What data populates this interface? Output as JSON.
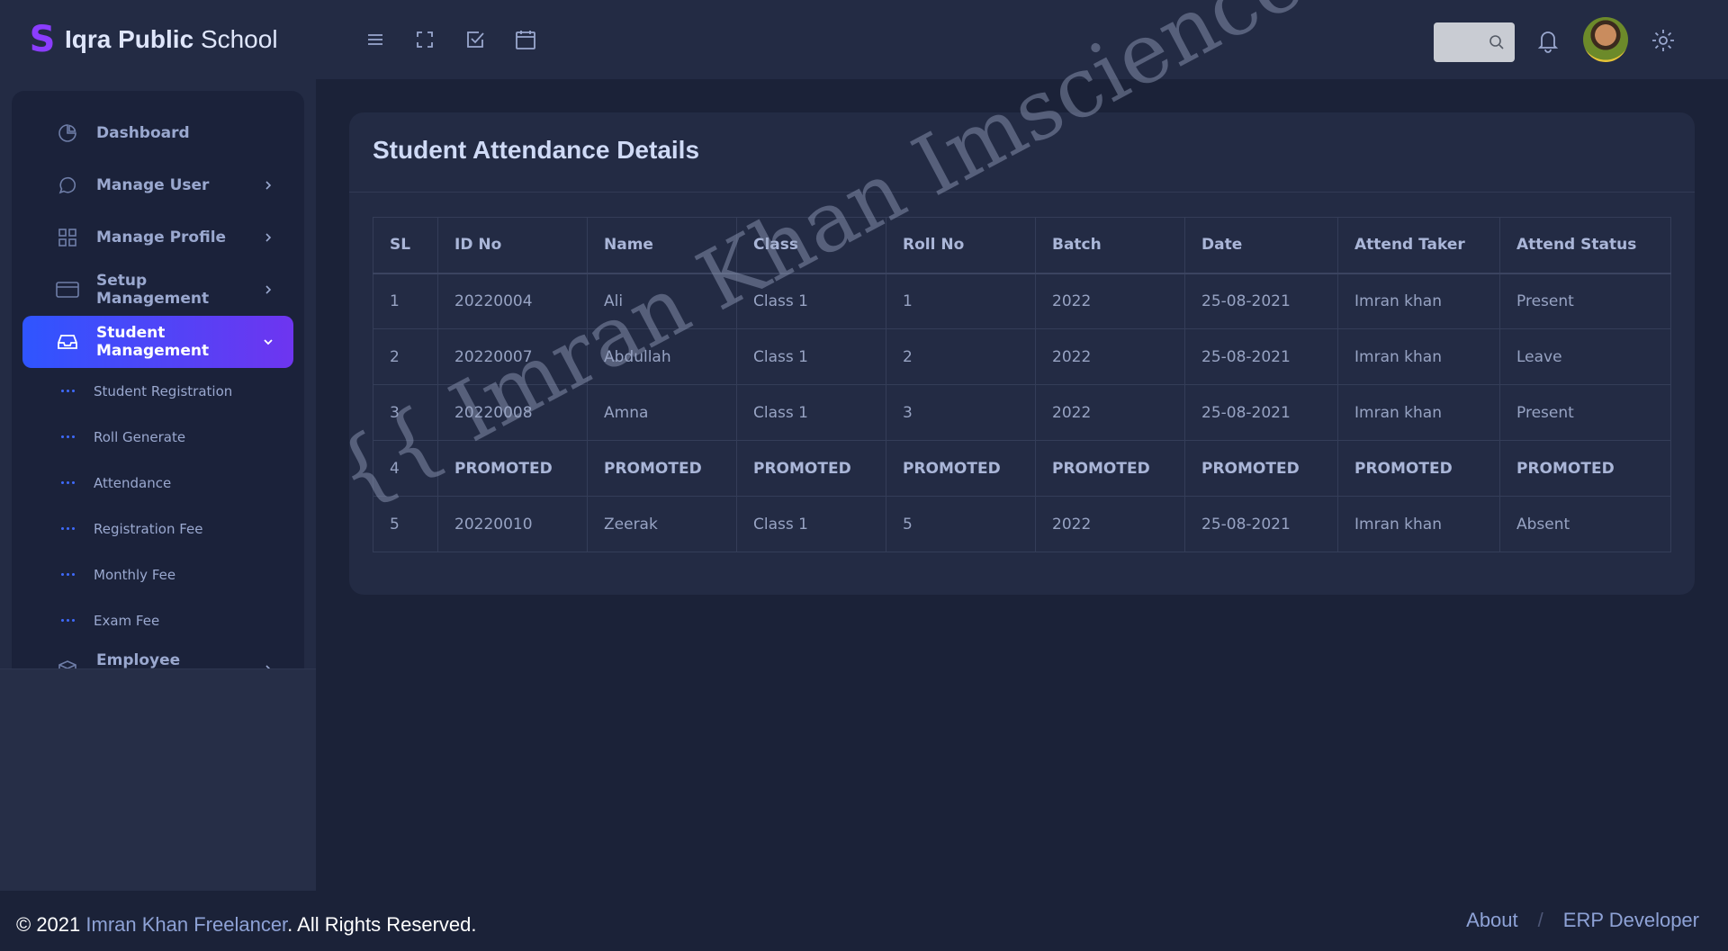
{
  "brand": {
    "logo": "S",
    "name_bold": "Iqra Public",
    "name_light": "School"
  },
  "sidebar": {
    "items": [
      {
        "label": "Dashboard",
        "icon": "pie-chart-icon",
        "chevron": false
      },
      {
        "label": "Manage User",
        "icon": "chat-bubble-icon",
        "chevron": true
      },
      {
        "label": "Manage Profile",
        "icon": "grid-icon",
        "chevron": true
      },
      {
        "label": "Setup Management",
        "icon": "credit-card-icon",
        "chevron": true
      },
      {
        "label": "Student Management",
        "icon": "inbox-icon",
        "chevron": true,
        "active": true
      }
    ],
    "submenu": [
      {
        "label": "Student Registration"
      },
      {
        "label": "Roll Generate"
      },
      {
        "label": "Attendance"
      },
      {
        "label": "Registration Fee"
      },
      {
        "label": "Monthly Fee"
      },
      {
        "label": "Exam Fee"
      }
    ],
    "after": {
      "label": "Employee Management",
      "icon": "box-icon"
    }
  },
  "topbar": {
    "icons": [
      "menu-icon",
      "fullscreen-icon",
      "checkbox-icon",
      "calendar-icon"
    ],
    "search": {
      "placeholder": ""
    }
  },
  "card": {
    "title": "Student Attendance Details",
    "columns": [
      "SL",
      "ID No",
      "Name",
      "Class",
      "Roll No",
      "Batch",
      "Date",
      "Attend Taker",
      "Attend Status"
    ],
    "rows": [
      [
        "1",
        "20220004",
        "Ali",
        "Class 1",
        "1",
        "2022",
        "25-08-2021",
        "Imran khan",
        "Present"
      ],
      [
        "2",
        "20220007",
        "Abdullah",
        "Class 1",
        "2",
        "2022",
        "25-08-2021",
        "Imran khan",
        "Leave"
      ],
      [
        "3",
        "20220008",
        "Amna",
        "Class 1",
        "3",
        "2022",
        "25-08-2021",
        "Imran khan",
        "Present"
      ],
      [
        "4",
        "PROMOTED",
        "PROMOTED",
        "PROMOTED",
        "PROMOTED",
        "PROMOTED",
        "PROMOTED",
        "PROMOTED",
        "PROMOTED"
      ],
      [
        "5",
        "20220010",
        "Zeerak",
        "Class 1",
        "5",
        "2022",
        "25-08-2021",
        "Imran khan",
        "Absent"
      ]
    ]
  },
  "watermark": "{{ Imran Khan Imsciences }}",
  "footer": {
    "copyright_prefix": "© 2021 ",
    "company": "Imran Khan Freelancer",
    "copyright_suffix": ". All Rights Reserved.",
    "links": [
      "About",
      "ERP Developer"
    ],
    "separator": "/"
  },
  "colors": {
    "accent_start": "#2f55ff",
    "accent_end": "#6e35f0",
    "background": "#1b2238",
    "panel": "#232b44"
  }
}
